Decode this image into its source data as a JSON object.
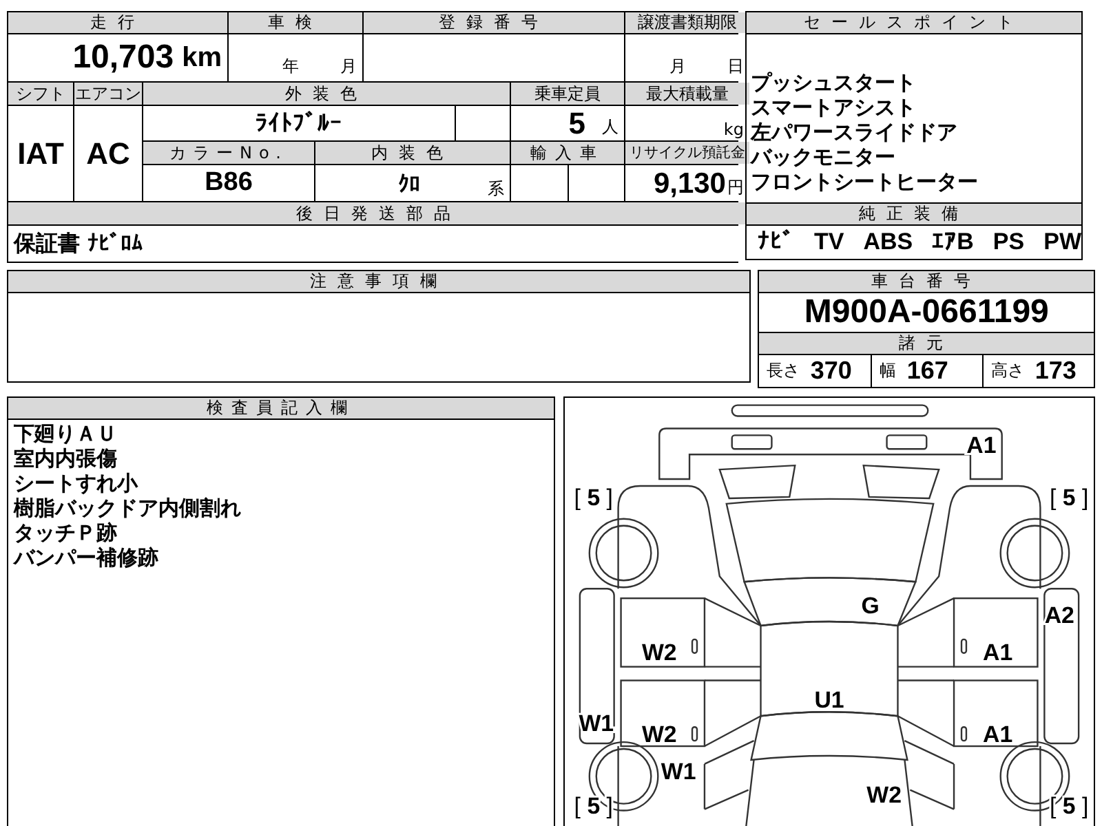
{
  "vehicle_info": {
    "mileage": {
      "label": "走行",
      "value": "10,703",
      "unit": "km"
    },
    "inspection": {
      "label": "車検",
      "year_unit": "年",
      "month_unit": "月"
    },
    "registration_number": {
      "label": "登録番号"
    },
    "transfer_deadline": {
      "label": "譲渡書類期限",
      "month_unit": "月",
      "day_unit": "日"
    },
    "shift": {
      "label": "シフト",
      "value": "IAT"
    },
    "air_conditioner": {
      "label": "エアコン",
      "value": "AC"
    },
    "exterior_color": {
      "label": "外装色",
      "value": "ﾗｲﾄﾌﾞﾙｰ"
    },
    "capacity": {
      "label": "乗車定員",
      "value": "5",
      "unit": "人"
    },
    "max_load": {
      "label": "最大積載量",
      "unit": "kg"
    },
    "color_number": {
      "label": "カラーNo.",
      "value": "B86"
    },
    "interior_color": {
      "label": "内装色",
      "value": "ｸﾛ",
      "suffix": "系"
    },
    "imported": {
      "label": "輸入車"
    },
    "recycling_deposit": {
      "label": "リサイクル預託金",
      "value": "9,130",
      "unit": "円"
    },
    "parts_sent_later": {
      "label": "後日発送部品",
      "value": "保証書 ﾅﾋﾞﾛﾑ"
    }
  },
  "sales_points": {
    "label": "セールスポイント",
    "items": [
      "プッシュスタート",
      "スマートアシスト",
      "左パワースライドドア",
      "バックモニター",
      "フロントシートヒーター"
    ]
  },
  "genuine_equipment": {
    "label": "純正装備",
    "items": [
      "ﾅﾋﾞ",
      "TV",
      "ABS",
      "ｴｱB",
      "PS",
      "PW"
    ]
  },
  "notes": {
    "label": "注意事項欄"
  },
  "chassis": {
    "label": "車台番号",
    "value": "M900A-0661199"
  },
  "specs": {
    "label": "諸元",
    "items": [
      {
        "label": "長さ",
        "value": "370"
      },
      {
        "label": "幅",
        "value": "167"
      },
      {
        "label": "高さ",
        "value": "173"
      }
    ]
  },
  "inspector_notes": {
    "label": "検査員記入欄",
    "lines": [
      "下廻りＡＵ",
      "室内内張傷",
      "シートすれ小",
      "樹脂バックドア内側割れ",
      "タッチＰ跡",
      "バンパー補修跡"
    ]
  },
  "damage_diagram": {
    "marks": [
      {
        "text": "A1"
      },
      {
        "text": "[ **5** ]"
      },
      {
        "text": "[ **5** ]"
      },
      {
        "text": "G"
      },
      {
        "text": "A2"
      },
      {
        "text": "W2"
      },
      {
        "text": "A1"
      },
      {
        "text": "U1"
      },
      {
        "text": "W1"
      },
      {
        "text": "W2"
      },
      {
        "text": "A1"
      },
      {
        "text": "W1"
      },
      {
        "text": "W2"
      },
      {
        "text": "[ **5** ]"
      },
      {
        "text": "[ **5** ]"
      }
    ]
  }
}
